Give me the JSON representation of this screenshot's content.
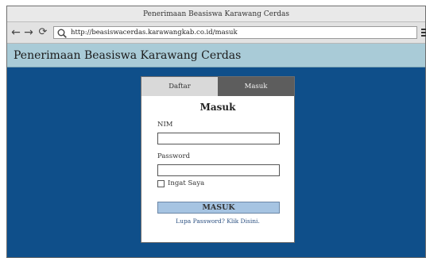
{
  "window": {
    "title": "Penerimaan Beasiswa Karawang Cerdas"
  },
  "browser": {
    "url": "http://beasiswacerdas.karawangkab.co.id/masuk",
    "back_icon": "back-arrow-icon",
    "forward_icon": "forward-arrow-icon",
    "reload_icon": "reload-icon",
    "search_icon": "search-icon",
    "menu_icon": "hamburger-menu-icon"
  },
  "header": {
    "title": "Penerimaan Beasiswa Karawang Cerdas"
  },
  "tabs": [
    {
      "label": "Daftar"
    },
    {
      "label": "Masuk"
    }
  ],
  "form": {
    "title": "Masuk",
    "nim_label": "NIM",
    "nim_value": "",
    "password_label": "Password",
    "password_value": "",
    "remember_label": "Ingat Saya",
    "submit_label": "MASUK",
    "forgot_text": "Lupa Password? Klik Disini."
  },
  "colors": {
    "page_bg": "#0f4f8a",
    "header_bg": "#a9cbd7",
    "submit_bg": "#a6c4e2",
    "active_tab_bg": "#5d5d5d"
  }
}
